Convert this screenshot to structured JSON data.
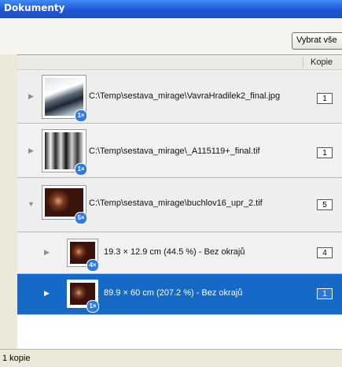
{
  "window": {
    "title": "Dokumenty"
  },
  "toolbar": {
    "select_all_label": "Vybrat vše"
  },
  "table": {
    "columns": {
      "kopie": "Kopie"
    },
    "rows": [
      {
        "path": "C:\\Temp\\sestava_mirage\\VavraHradilek2_final.jpg",
        "badge": "1×",
        "copies": "1",
        "expanded": false,
        "selected": false
      },
      {
        "path": "C:\\Temp\\sestava_mirage\\_A115119+_final.tif",
        "badge": "1×",
        "copies": "1",
        "expanded": false,
        "selected": false
      },
      {
        "path": "C:\\Temp\\sestava_mirage\\buchlov16_upr_2.tif",
        "badge": "5×",
        "copies": "5",
        "expanded": true,
        "selected": false
      },
      {
        "path": "19.3 × 12.9 cm (44.5 %) - Bez okrajů",
        "badge": "4×",
        "copies": "4",
        "expanded": false,
        "selected": false
      },
      {
        "path": "89.9 × 60 cm (207.2 %) - Bez okrajů",
        "badge": "1×",
        "copies": "1",
        "expanded": false,
        "selected": true
      }
    ]
  },
  "status": {
    "text": "1 kopie"
  },
  "colors": {
    "titlebar": "#2058d8",
    "selection": "#1569c7",
    "badge": "#2c7be5"
  },
  "icons": {
    "collapsed": "triangle-right-icon",
    "expanded": "triangle-down-icon"
  }
}
